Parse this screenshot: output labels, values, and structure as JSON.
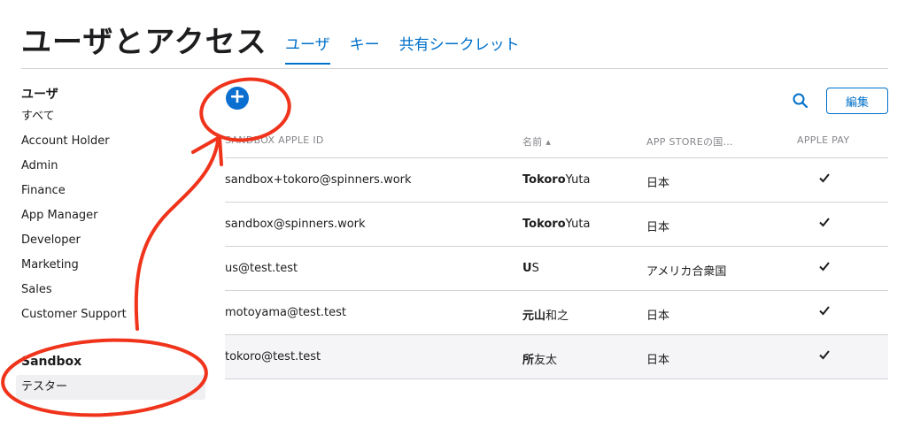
{
  "header": {
    "title": "ユーザとアクセス",
    "tabs": [
      {
        "label": "ユーザ"
      },
      {
        "label": "キー"
      },
      {
        "label": "共有シークレット"
      }
    ]
  },
  "sidebar": {
    "users_heading": "ユーザ",
    "items": [
      {
        "label": "すべて"
      },
      {
        "label": "Account Holder"
      },
      {
        "label": "Admin"
      },
      {
        "label": "Finance"
      },
      {
        "label": "App Manager"
      },
      {
        "label": "Developer"
      },
      {
        "label": "Marketing"
      },
      {
        "label": "Sales"
      },
      {
        "label": "Customer Support"
      }
    ],
    "sandbox_heading": "Sandbox",
    "sandbox_item": "テスター"
  },
  "toolbar": {
    "add_label": "+",
    "edit_label": "編集"
  },
  "table": {
    "columns": [
      "SANDBOX APPLE ID",
      "名前 ▴",
      "APP STOREの国…",
      "APPLE PAY"
    ],
    "rows": [
      {
        "email": "sandbox+tokoro@spinners.work",
        "last": "Tokoro",
        "first": "Yuta",
        "country": "日本"
      },
      {
        "email": "sandbox@spinners.work",
        "last": "Tokoro",
        "first": "Yuta",
        "country": "日本"
      },
      {
        "email": "us@test.test",
        "last": "U",
        "first": "S",
        "country": "アメリカ合衆国"
      },
      {
        "email": "motoyama@test.test",
        "last": "元山",
        "first": "和之",
        "country": "日本"
      },
      {
        "email": "tokoro@test.test",
        "last": "所",
        "first": "友太",
        "country": "日本"
      }
    ]
  },
  "colors": {
    "accent": "#0070c9",
    "annotation": "#f0341c"
  },
  "icons": {
    "search": "search-icon",
    "check": "checkmark-icon",
    "add": "plus-circle-icon"
  }
}
